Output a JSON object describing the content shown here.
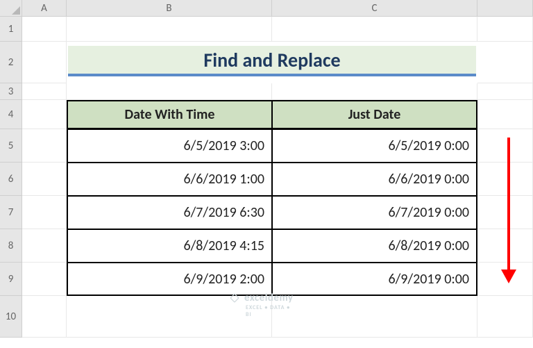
{
  "columns": [
    "A",
    "B",
    "C"
  ],
  "rows": [
    "1",
    "2",
    "3",
    "4",
    "5",
    "6",
    "7",
    "8",
    "9",
    "10"
  ],
  "title": "Find and Replace",
  "headers": {
    "b": "Date With Time",
    "c": "Just Date"
  },
  "data": [
    {
      "b": "6/5/2019 3:00",
      "c": "6/5/2019 0:00"
    },
    {
      "b": "6/6/2019 1:00",
      "c": "6/6/2019 0:00"
    },
    {
      "b": "6/7/2019 6:30",
      "c": "6/7/2019 0:00"
    },
    {
      "b": "6/8/2019 4:15",
      "c": "6/8/2019 0:00"
    },
    {
      "b": "6/9/2019 2:00",
      "c": "6/9/2019 0:00"
    }
  ],
  "watermark": {
    "name": "exceldemy",
    "tagline": "EXCEL • DATA • BI"
  },
  "chart_data": {
    "type": "table",
    "title": "Find and Replace",
    "columns": [
      "Date With Time",
      "Just Date"
    ],
    "rows": [
      [
        "6/5/2019 3:00",
        "6/5/2019 0:00"
      ],
      [
        "6/6/2019 1:00",
        "6/6/2019 0:00"
      ],
      [
        "6/7/2019 6:30",
        "6/7/2019 0:00"
      ],
      [
        "6/8/2019 4:15",
        "6/8/2019 0:00"
      ],
      [
        "6/9/2019 2:00",
        "6/9/2019 0:00"
      ]
    ]
  }
}
